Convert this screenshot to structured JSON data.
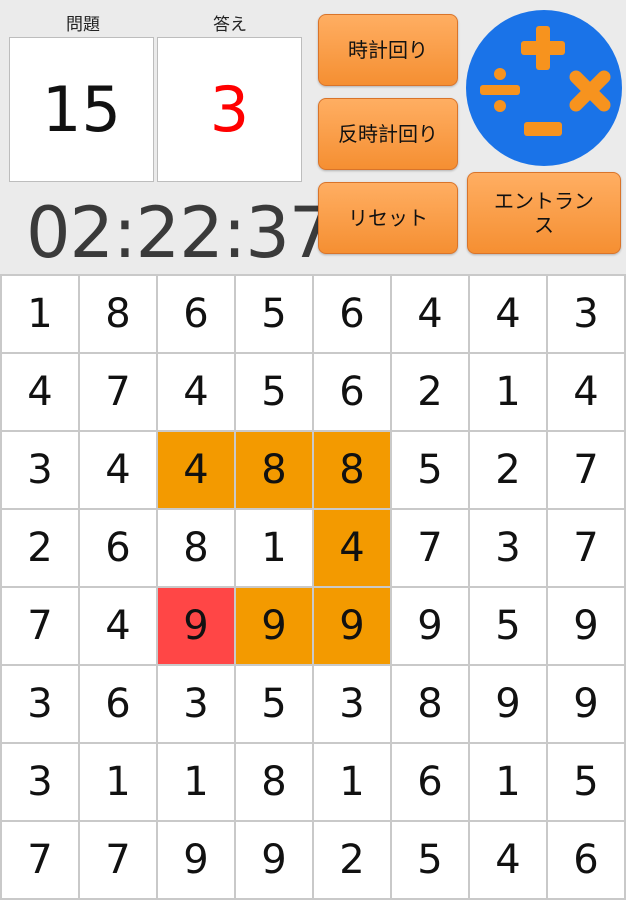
{
  "header": {
    "problem_label": "問題",
    "answer_label": "答え",
    "problem_value": "15",
    "answer_value": "3",
    "timer": "02:22:37"
  },
  "buttons": {
    "clockwise": "時計回り",
    "counter_clockwise": "反時計回り",
    "reset": "リセット",
    "entrance": "エントランス"
  },
  "logo": {
    "icon": "math-operators-logo",
    "bg_color": "#1a73e8",
    "symbol_color": "#f7931e"
  },
  "colors": {
    "selected": "#f39a00",
    "current": "#ff4646",
    "answer_text": "#ff0000"
  },
  "grid": {
    "rows": [
      [
        "1",
        "8",
        "6",
        "5",
        "6",
        "4",
        "4",
        "3"
      ],
      [
        "4",
        "7",
        "4",
        "5",
        "6",
        "2",
        "1",
        "4"
      ],
      [
        "3",
        "4",
        "4",
        "8",
        "8",
        "5",
        "2",
        "7"
      ],
      [
        "2",
        "6",
        "8",
        "1",
        "4",
        "7",
        "3",
        "7"
      ],
      [
        "7",
        "4",
        "9",
        "9",
        "9",
        "9",
        "5",
        "9"
      ],
      [
        "3",
        "6",
        "3",
        "5",
        "3",
        "8",
        "9",
        "9"
      ],
      [
        "3",
        "1",
        "1",
        "8",
        "1",
        "6",
        "1",
        "5"
      ],
      [
        "7",
        "7",
        "9",
        "9",
        "2",
        "5",
        "4",
        "6"
      ]
    ],
    "selected": [
      [
        2,
        2
      ],
      [
        2,
        3
      ],
      [
        2,
        4
      ],
      [
        3,
        4
      ],
      [
        4,
        3
      ],
      [
        4,
        4
      ]
    ],
    "current": [
      [
        4,
        2
      ]
    ]
  }
}
